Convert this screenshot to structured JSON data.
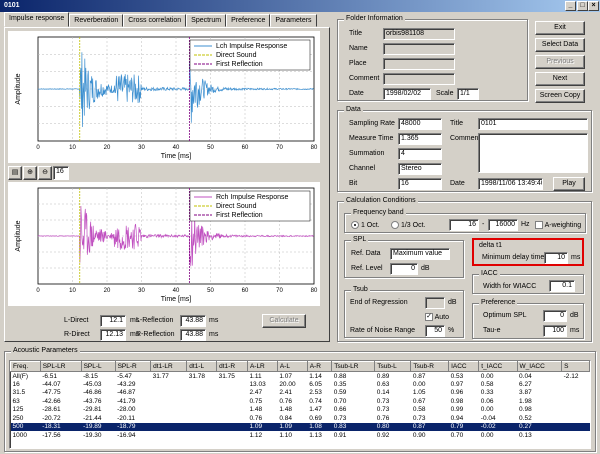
{
  "window": {
    "title": "0101"
  },
  "tabs": [
    {
      "label": "Impulse response",
      "active": true
    },
    {
      "label": "Reverberation"
    },
    {
      "label": "Cross correlation"
    },
    {
      "label": "Spectrum"
    },
    {
      "label": "Preference"
    },
    {
      "label": "Parameters"
    }
  ],
  "plot_top": {
    "legend": [
      "Lch Impulse Response",
      "Direct Sound",
      "First Reflection"
    ],
    "ylabel": "Amplitude",
    "xlabel": "Time [ms]",
    "xticks": [
      "0",
      "10",
      "20",
      "30",
      "40",
      "50",
      "60",
      "70",
      "80"
    ],
    "line_color": "#3c8fd0"
  },
  "plot_bottom": {
    "legend": [
      "Rch Impulse Response",
      "Direct Sound",
      "First Reflection"
    ],
    "ylabel": "Amplitude",
    "xlabel": "Time [ms]",
    "xticks": [
      "0",
      "10",
      "20",
      "30",
      "40",
      "50",
      "60",
      "70",
      "80"
    ],
    "line_color": "#c050c0"
  },
  "plot_toolbar": {
    "zoom_value": "16"
  },
  "reflections": {
    "l_direct_label": "L-Direct",
    "l_direct": "12.1",
    "l_direct_unit": "ms",
    "r_direct_label": "R-Direct",
    "r_direct": "12.13",
    "r_direct_unit": "ms",
    "l_reflection_label": "L-Reflection",
    "l_reflection": "43.88",
    "l_reflection_unit": "ms",
    "r_reflection_label": "R-Reflection",
    "r_reflection": "43.88",
    "r_reflection_unit": "ms",
    "calculate": "Calculate"
  },
  "folder": {
    "title": "Folder Information",
    "title_label": "Title",
    "title_value": "orbis981108",
    "name_label": "Name",
    "name_value": "",
    "place_label": "Place",
    "place_value": "",
    "comment_label": "Comment",
    "comment_value": "",
    "date_label": "Date",
    "date_value": "1998/02/02",
    "scale_label": "Scale",
    "scale_value": "1/1"
  },
  "buttons": {
    "exit": "Exit",
    "select_data": "Select Data",
    "previous": "Previous",
    "next": "Next",
    "screen_copy": "Screen Copy"
  },
  "data": {
    "title": "Data",
    "sampling_rate_label": "Sampling Rate",
    "sampling_rate": "48000",
    "measure_time_label": "Measure Time",
    "measure_time": "1.365",
    "summation_label": "Summation",
    "summation": "4",
    "channel_label": "Channel",
    "channel": "Stereo",
    "bit_label": "Bit",
    "bit": "16",
    "title2_label": "Title",
    "title2": "0101",
    "comment_label": "Comment",
    "comment": "",
    "date_label": "Date",
    "date": "1998/11/06 13:49:40",
    "play": "Play"
  },
  "calc": {
    "title": "Calculation Conditions",
    "frequency_band": "Frequency band",
    "oct1": "1 Oct.",
    "oct3": "1/3 Oct.",
    "f_low": "16",
    "f_high": "16000",
    "f_unit": "Hz",
    "a_weighting": "A-weighting",
    "spl_title": "SPL",
    "ref_data_label": "Ref. Data",
    "ref_data": "Maximum value",
    "ref_level_label": "Ref. Level",
    "ref_level": "0",
    "ref_level_unit": "dB",
    "delta_title": "delta t1",
    "min_delay_label": "Minimum delay time",
    "min_delay": "10",
    "min_delay_unit": "ms",
    "tsub_title": "Tsub",
    "end_regression_label": "End of Regression",
    "end_regression": "",
    "end_regression_unit": "dB",
    "auto": "Auto",
    "noise_label": "Rate of Noise Range",
    "noise": "50",
    "noise_unit": "%",
    "iacc_title": "IACC",
    "width_label": "Width for WIACC",
    "width": "0.1",
    "pref_title": "Preference",
    "opt_spl_label": "Optimum SPL",
    "opt_spl": "0",
    "opt_spl_unit": "dB",
    "tau_label": "Tau-e",
    "tau": "100",
    "tau_unit": "ms"
  },
  "acoustic": {
    "title": "Acoustic Parameters",
    "columns": [
      "Freq.",
      "SPL-LR",
      "SPL-L",
      "SPL-R",
      "dt1-LR",
      "dt1-L",
      "dt1-R",
      "A-LR",
      "A-L",
      "A-R",
      "Tsub-LR",
      "Tsub-L",
      "Tsub-R",
      "IACC",
      "t_IACC",
      "W_IACC",
      "S"
    ],
    "rows": [
      [
        "All(F)",
        "-6.51",
        "-8.15",
        "-5.47",
        "31.77",
        "31.78",
        "31.75",
        "1.11",
        "1.07",
        "1.14",
        "0.88",
        "0.89",
        "0.87",
        "0.53",
        "0.00",
        "0.04",
        "-2.12"
      ],
      [
        "16",
        "-44.07",
        "-45.03",
        "-43.29",
        "",
        "",
        "",
        "13.03",
        "20.00",
        "6.05",
        "0.35",
        "0.63",
        "0.00",
        "0.97",
        "0.58",
        "6.27",
        ""
      ],
      [
        "31.5",
        "-47.75",
        "-46.86",
        "-46.87",
        "",
        "",
        "",
        "2.47",
        "2.41",
        "2.53",
        "0.59",
        "0.14",
        "1.05",
        "0.96",
        "0.33",
        "3.87",
        ""
      ],
      [
        "63",
        "-42.66",
        "-43.76",
        "-41.79",
        "",
        "",
        "",
        "0.75",
        "0.76",
        "0.74",
        "0.70",
        "0.73",
        "0.67",
        "0.98",
        "0.06",
        "1.98",
        ""
      ],
      [
        "125",
        "-28.61",
        "-29.81",
        "-28.00",
        "",
        "",
        "",
        "1.48",
        "1.48",
        "1.47",
        "0.66",
        "0.73",
        "0.58",
        "0.99",
        "0.00",
        "0.98",
        ""
      ],
      [
        "250",
        "-20.72",
        "-21.44",
        "-20.11",
        "",
        "",
        "",
        "0.76",
        "0.84",
        "0.69",
        "0.73",
        "0.76",
        "0.73",
        "0.94",
        "-0.04",
        "0.52",
        ""
      ],
      [
        "500",
        "-18.31",
        "-19.89",
        "-18.79",
        "",
        "",
        "",
        "1.09",
        "1.09",
        "1.08",
        "0.83",
        "0.80",
        "0.87",
        "0.79",
        "-0.02",
        "0.27",
        ""
      ],
      [
        "1000",
        "-17.56",
        "-19.30",
        "-16.94",
        "",
        "",
        "",
        "1.12",
        "1.10",
        "1.13",
        "0.91",
        "0.92",
        "0.90",
        "0.70",
        "0.00",
        "0.13",
        ""
      ]
    ],
    "selected_row": 6
  }
}
